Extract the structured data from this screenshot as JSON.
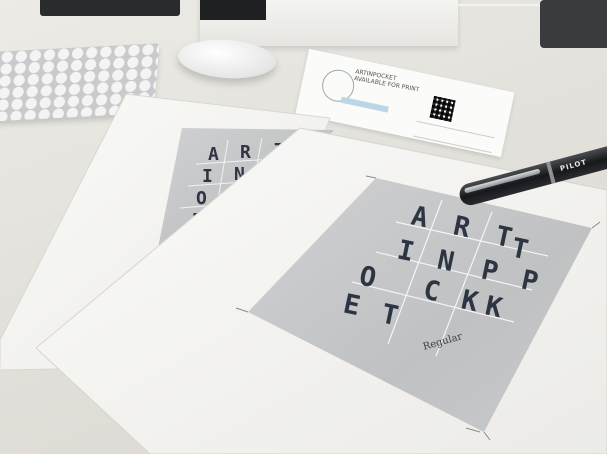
{
  "poster_front": {
    "grid_rows": [
      [
        "A",
        "R",
        "T",
        ""
      ],
      [
        "I",
        "N",
        "P",
        ""
      ],
      [
        "O",
        "C",
        "K",
        ""
      ],
      [
        "E",
        "T",
        "",
        ""
      ]
    ],
    "detached_letter": "T",
    "style_label": "Regular"
  },
  "poster_back": {
    "grid_rows": [
      [
        "A",
        "R",
        "T"
      ],
      [
        "I",
        "N",
        "P"
      ],
      [
        "O",
        "C",
        "K"
      ],
      [
        "E",
        "T",
        ""
      ]
    ]
  },
  "pen": {
    "brand": "PILOT"
  },
  "postcard": {
    "lines": [
      "ARTINPOCKET",
      "AVAILABLE FOR PRINT"
    ]
  },
  "colors": {
    "desk": "#e4e2dc",
    "paper": "#f7f7f5",
    "poster_bg": "#c7c9cb",
    "letters": "#2e3542"
  },
  "objects": [
    "keyboard",
    "mouse",
    "postcard",
    "paper-sheet",
    "poster",
    "pen"
  ]
}
